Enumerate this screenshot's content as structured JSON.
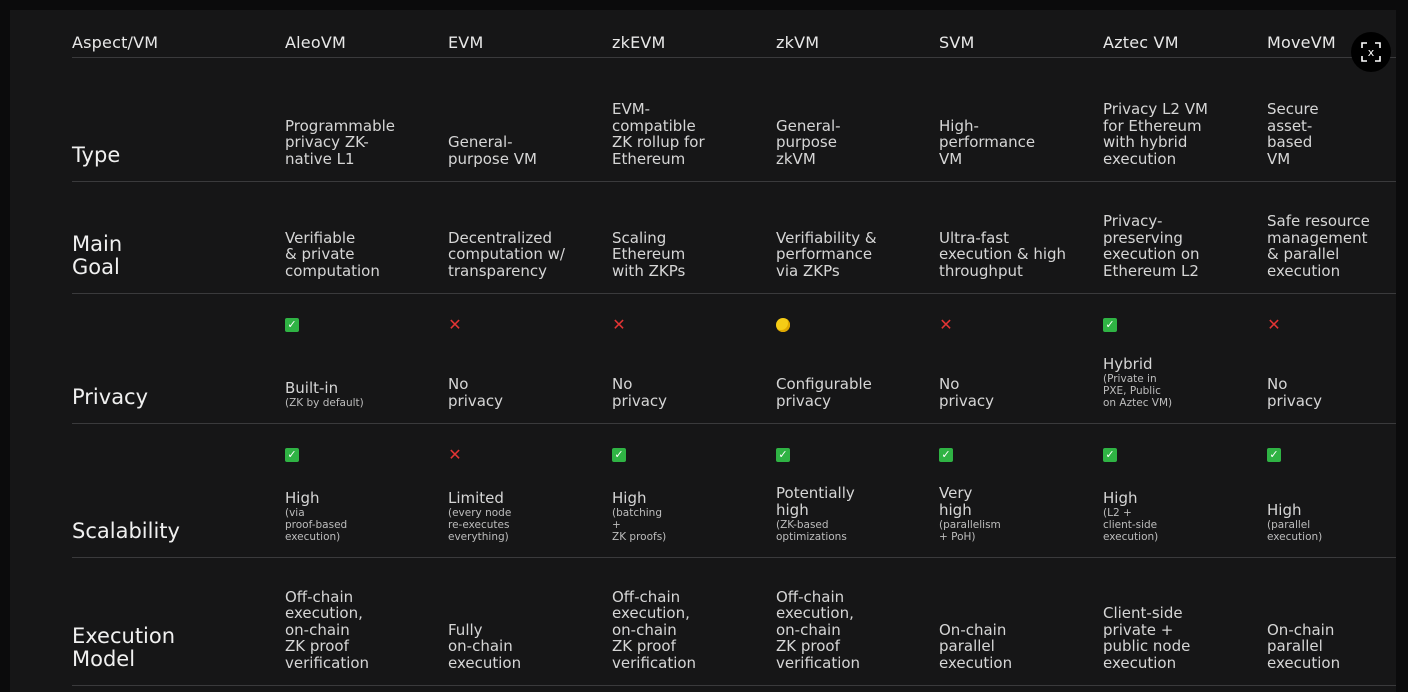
{
  "headers": [
    "Aspect/VM",
    "AleoVM",
    "EVM",
    "zkEVM",
    "zkVM",
    "SVM",
    "Aztec VM",
    "MoveVM"
  ],
  "rows": [
    {
      "aspect": "Type",
      "cells": [
        {
          "text": "Programmable\nprivacy ZK-\nnative L1"
        },
        {
          "text": "General-\npurpose VM"
        },
        {
          "text": "EVM-\ncompatible\nZK rollup for\nEthereum"
        },
        {
          "text": "General-\npurpose\nzkVM"
        },
        {
          "text": "High-\nperformance\nVM"
        },
        {
          "text": "Privacy L2 VM\nfor Ethereum\nwith hybrid\nexecution"
        },
        {
          "text": "Secure\nasset-\nbased\nVM"
        }
      ]
    },
    {
      "aspect": "Main\nGoal",
      "cells": [
        {
          "text": "Verifiable\n& private\ncomputation"
        },
        {
          "text": "Decentralized\ncomputation w/\ntransparency"
        },
        {
          "text": "Scaling\nEthereum\nwith ZKPs"
        },
        {
          "text": "Verifiability &\nperformance\nvia ZKPs"
        },
        {
          "text": "Ultra-fast\nexecution & high\nthroughput"
        },
        {
          "text": "Privacy-\npreserving\nexecution on\nEthereum L2"
        },
        {
          "text": "Safe resource\nmanagement\n& parallel\nexecution"
        }
      ]
    },
    {
      "aspect": "Privacy",
      "cells": [
        {
          "mark": "check",
          "glyph": "✓",
          "text": "Built-in",
          "sub": "(ZK by default)"
        },
        {
          "mark": "cross",
          "glyph": "✕",
          "text": "No\nprivacy",
          "sub": ""
        },
        {
          "mark": "cross",
          "glyph": "✕",
          "text": "No\nprivacy",
          "sub": ""
        },
        {
          "mark": "partial",
          "glyph": "●",
          "text": "Configurable\nprivacy",
          "sub": ""
        },
        {
          "mark": "cross",
          "glyph": "✕",
          "text": "No\nprivacy",
          "sub": ""
        },
        {
          "mark": "check",
          "glyph": "✓",
          "text": "Hybrid",
          "sub": "(Private in\nPXE, Public\non Aztec VM)"
        },
        {
          "mark": "cross",
          "glyph": "✕",
          "text": "No\nprivacy",
          "sub": ""
        }
      ]
    },
    {
      "aspect": "Scalability",
      "cells": [
        {
          "mark": "check",
          "glyph": "✓",
          "text": "High",
          "sub": "(via\nproof-based\nexecution)"
        },
        {
          "mark": "cross",
          "glyph": "✕",
          "text": "Limited",
          "sub": "(every node\nre-executes\neverything)"
        },
        {
          "mark": "check",
          "glyph": "✓",
          "text": "High",
          "sub": "(batching\n+\nZK proofs)"
        },
        {
          "mark": "check",
          "glyph": "✓",
          "text": "Potentially\nhigh",
          "sub": "(ZK-based\noptimizations"
        },
        {
          "mark": "check",
          "glyph": "✓",
          "text": "Very\nhigh",
          "sub": "(parallelism\n+ PoH)"
        },
        {
          "mark": "check",
          "glyph": "✓",
          "text": "High",
          "sub": "(L2 +\nclient-side\nexecution)"
        },
        {
          "mark": "check",
          "glyph": "✓",
          "text": "High",
          "sub": "(parallel\nexecution)"
        }
      ]
    },
    {
      "aspect": "Execution\nModel",
      "cells": [
        {
          "text": "Off-chain\nexecution,\non-chain\nZK proof\nverification"
        },
        {
          "text": "Fully\non-chain\nexecution"
        },
        {
          "text": "Off-chain\nexecution,\non-chain\nZK proof\nverification"
        },
        {
          "text": "Off-chain\nexecution,\non-chain\nZK proof\nverification"
        },
        {
          "text": "On-chain\nparallel\nexecution"
        },
        {
          "text": "Client-side\nprivate +\npublic node\nexecution"
        },
        {
          "text": "On-chain\nparallel\nexecution"
        }
      ]
    }
  ],
  "close_button": {
    "icon": "close-icon",
    "glyph": "x"
  },
  "colors": {
    "check": "#2fb344",
    "cross": "#e23434",
    "partial": "#f5cc16",
    "background": "#161617"
  }
}
